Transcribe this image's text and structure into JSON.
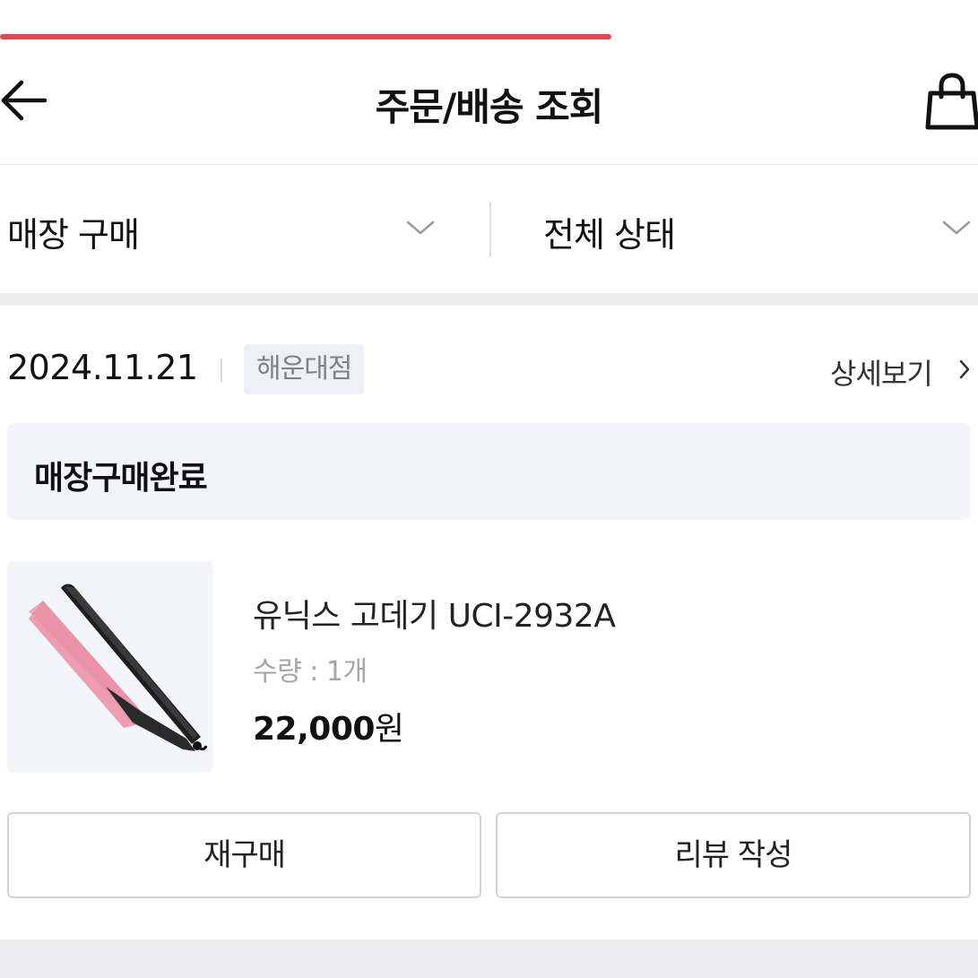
{
  "colors": {
    "accent": "#e8454f",
    "text": "#111111",
    "muted": "#a6a6a6",
    "divider": "#ececee",
    "surface": "#f3f5f9"
  },
  "progress": {
    "fraction": 0.625
  },
  "header": {
    "back_icon": "arrow-left-icon",
    "title": "주문/배송 조회",
    "bag_icon": "shopping-bag-icon"
  },
  "filters": {
    "purchase_type": {
      "selected": "매장 구매",
      "icon": "chevron-down-icon"
    },
    "status": {
      "selected": "전체 상태",
      "icon": "chevron-down-icon"
    }
  },
  "order": {
    "date": "2024.11.21",
    "store": "해운대점",
    "detail_label": "상세보기",
    "detail_icon": "chevron-right-icon",
    "status": "매장구매완료",
    "item": {
      "image_icon": "hair-straightener-image",
      "name": "유닉스 고데기 UCI-2932A",
      "quantity": "수량 : 1개",
      "price": "22,000",
      "currency": "원"
    },
    "actions": {
      "reorder": "재구매",
      "review": "리뷰 작성"
    }
  }
}
